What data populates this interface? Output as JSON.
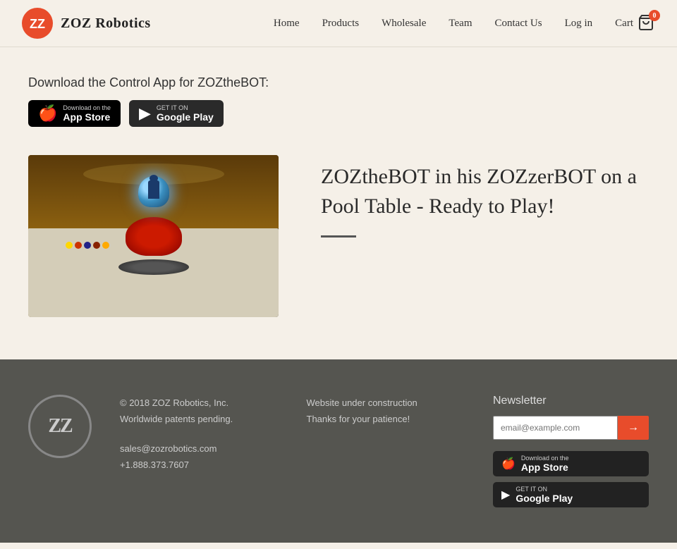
{
  "header": {
    "logo_text": "ZOZ Robotics",
    "nav": {
      "home": "Home",
      "products": "Products",
      "wholesale": "Wholesale",
      "team": "Team",
      "contact": "Contact Us",
      "login": "Log in",
      "cart": "Cart",
      "cart_count": "0"
    }
  },
  "main": {
    "download_title": "Download the Control App for ZOZtheBOT:",
    "app_store": {
      "small_text": "Download on the",
      "large_text": "App Store"
    },
    "google_play": {
      "small_text": "GET IT ON",
      "large_text": "Google Play"
    },
    "feature": {
      "title": "ZOZtheBOT in his ZOZzerBOT on a Pool Table - Ready to Play!"
    }
  },
  "footer": {
    "copyright": "© 2018 ZOZ Robotics, Inc.",
    "patents": "Worldwide patents pending.",
    "email": "sales@zozrobotics.com",
    "phone": "+1.888.373.7607",
    "website_status": "Website under construction",
    "patience": "Thanks for your patience!",
    "newsletter_title": "Newsletter",
    "newsletter_placeholder": "email@example.com",
    "app_store": {
      "small_text": "Download on the",
      "large_text": "App Store"
    },
    "google_play": {
      "small_text": "GET IT ON",
      "large_text": "Google Play"
    }
  }
}
